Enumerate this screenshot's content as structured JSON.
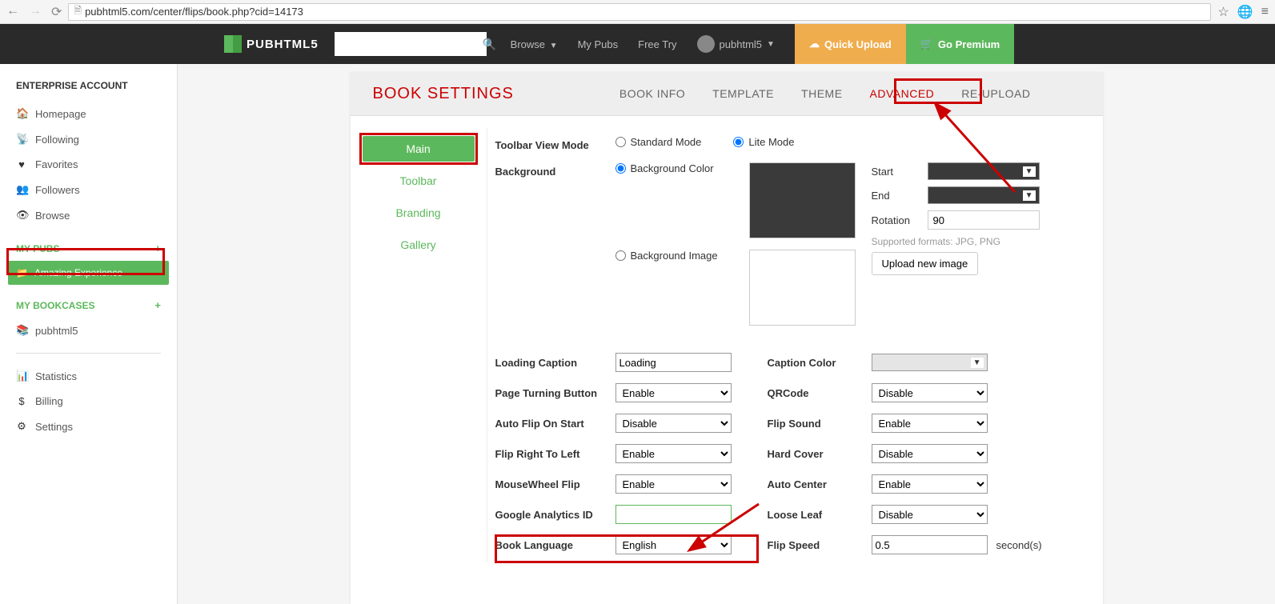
{
  "browser": {
    "url": "pubhtml5.com/center/flips/book.php?cid=14173"
  },
  "header": {
    "logo": "PUBHTML5",
    "nav": {
      "browse": "Browse",
      "mypubs": "My Pubs",
      "freetry": "Free Try",
      "username": "pubhtml5"
    },
    "btn_upload": "Quick Upload",
    "btn_premium": "Go Premium"
  },
  "sidebar": {
    "title": "ENTERPRISE ACCOUNT",
    "items": [
      {
        "icon": "🏠",
        "label": "Homepage"
      },
      {
        "icon": "📡",
        "label": "Following"
      },
      {
        "icon": "❤",
        "label": "Favorites"
      },
      {
        "icon": "👥",
        "label": "Followers"
      },
      {
        "icon": "👁",
        "label": "Browse"
      }
    ],
    "mypubs_header": "MY PUBS",
    "active_pub": "Amazing Experience",
    "bookcases_header": "MY BOOKCASES",
    "bookcase_item": "pubhtml5",
    "bottom": [
      {
        "icon": "📊",
        "label": "Statistics"
      },
      {
        "icon": "$",
        "label": "Billing"
      },
      {
        "icon": "⚙",
        "label": "Settings"
      }
    ]
  },
  "tabs": {
    "title": "BOOK SETTINGS",
    "items": [
      "BOOK INFO",
      "TEMPLATE",
      "THEME",
      "ADVANCED",
      "RE-UPLOAD"
    ],
    "active": "ADVANCED"
  },
  "subnav": [
    "Main",
    "Toolbar",
    "Branding",
    "Gallery"
  ],
  "form": {
    "toolbar_view": {
      "label": "Toolbar View Mode",
      "opt1": "Standard Mode",
      "opt2": "Lite Mode"
    },
    "background": {
      "label": "Background",
      "opt1": "Background Color",
      "opt2": "Background Image"
    },
    "bg_start": "Start",
    "bg_end": "End",
    "bg_rotation": "Rotation",
    "bg_rotation_val": "90",
    "supported": "Supported formats: JPG, PNG",
    "upload_btn": "Upload new image",
    "loading_caption": {
      "label": "Loading Caption",
      "value": "Loading"
    },
    "caption_color": "Caption Color",
    "page_turning": {
      "label": "Page Turning Button",
      "value": "Enable"
    },
    "qrcode": {
      "label": "QRCode",
      "value": "Disable"
    },
    "autoflip": {
      "label": "Auto Flip On Start",
      "value": "Disable"
    },
    "flipsound": {
      "label": "Flip Sound",
      "value": "Enable"
    },
    "rtl": {
      "label": "Flip Right To Left",
      "value": "Enable"
    },
    "hardcover": {
      "label": "Hard Cover",
      "value": "Disable"
    },
    "mousewheel": {
      "label": "MouseWheel Flip",
      "value": "Enable"
    },
    "autocenter": {
      "label": "Auto Center",
      "value": "Enable"
    },
    "ga": {
      "label": "Google Analytics ID",
      "value": ""
    },
    "looseleaf": {
      "label": "Loose Leaf",
      "value": "Disable"
    },
    "language": {
      "label": "Book Language",
      "value": "English"
    },
    "flipspeed": {
      "label": "Flip Speed",
      "value": "0.5",
      "suffix": "second(s)"
    }
  }
}
